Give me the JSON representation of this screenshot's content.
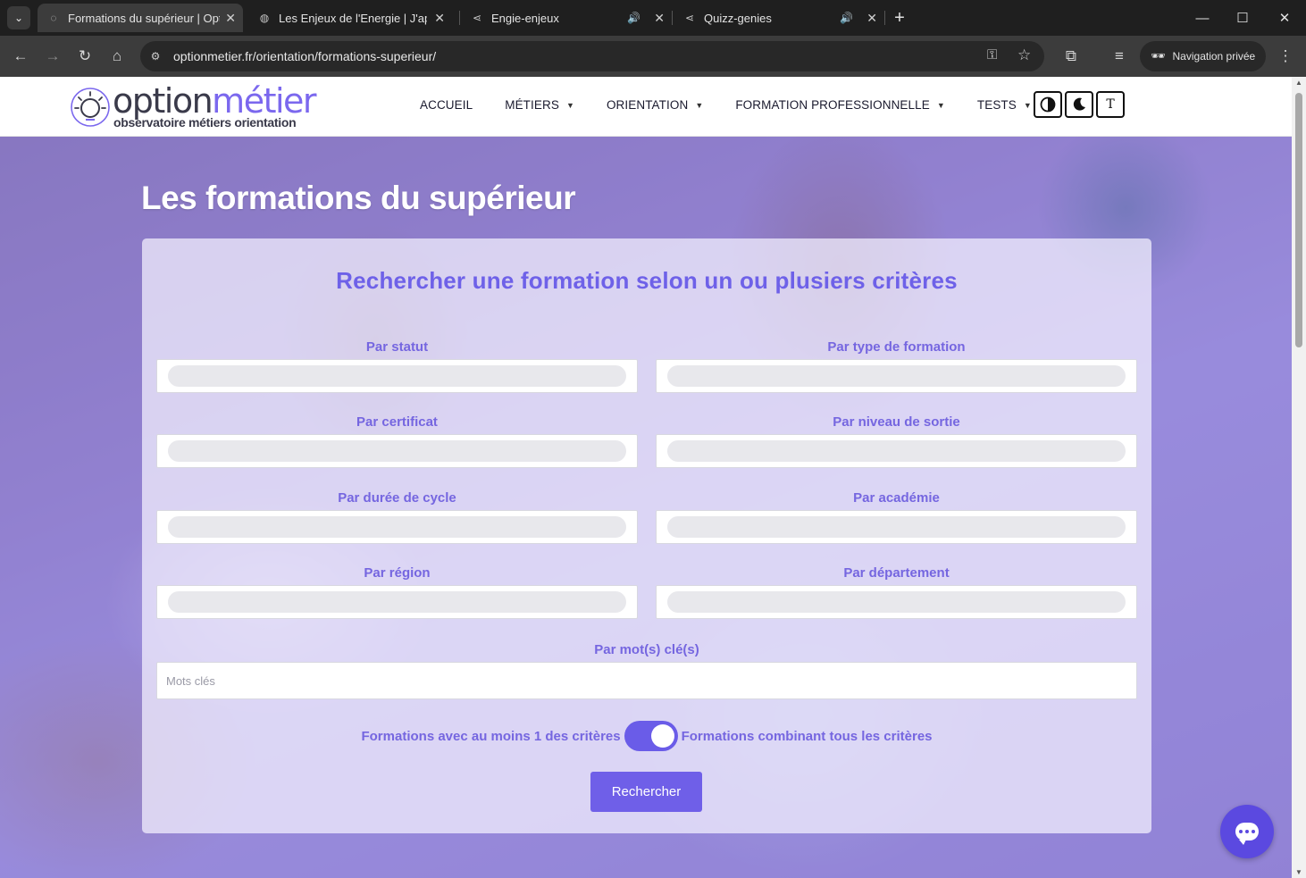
{
  "browser": {
    "tabs": [
      {
        "title": "Formations du supérieur | Optic",
        "active": true,
        "audio": false
      },
      {
        "title": "Les Enjeux de l'Energie | J'appre",
        "active": false,
        "audio": false
      },
      {
        "title": "Engie-enjeux",
        "active": false,
        "audio": true
      },
      {
        "title": "Quizz-genies",
        "active": false,
        "audio": true
      }
    ],
    "url": "optionmetier.fr/orientation/formations-superieur/",
    "private_label": "Navigation privée"
  },
  "site": {
    "logo": {
      "word1": "option",
      "word2": "métier",
      "tagline": "observatoire métiers orientation",
      "accent_color": "#7b68ee"
    },
    "nav": [
      {
        "label": "ACCUEIL",
        "dropdown": false
      },
      {
        "label": "MÉTIERS",
        "dropdown": true
      },
      {
        "label": "ORIENTATION",
        "dropdown": true
      },
      {
        "label": "FORMATION PROFESSIONNELLE",
        "dropdown": true
      },
      {
        "label": "TESTS",
        "dropdown": true
      }
    ],
    "a11y_buttons": [
      "contrast-icon",
      "dark-mode-icon",
      "font-size-icon"
    ],
    "a11y_font_glyph": "T"
  },
  "page": {
    "title": "Les formations du supérieur",
    "card_heading": "Rechercher une formation selon un ou plusiers critères",
    "filters": [
      {
        "label": "Par statut"
      },
      {
        "label": "Par type de formation"
      },
      {
        "label": "Par certificat"
      },
      {
        "label": "Par niveau de sortie"
      },
      {
        "label": "Par durée de cycle"
      },
      {
        "label": "Par académie"
      },
      {
        "label": "Par région"
      },
      {
        "label": "Par département"
      }
    ],
    "keywords": {
      "label": "Par mot(s) clé(s)",
      "placeholder": "Mots clés",
      "value": ""
    },
    "toggle": {
      "left_label": "Formations avec au moins 1 des critères",
      "right_label": "Formations combinant tous les critères",
      "state": "right"
    },
    "search_button": "Rechercher",
    "primary_color": "#6f5fe8"
  }
}
